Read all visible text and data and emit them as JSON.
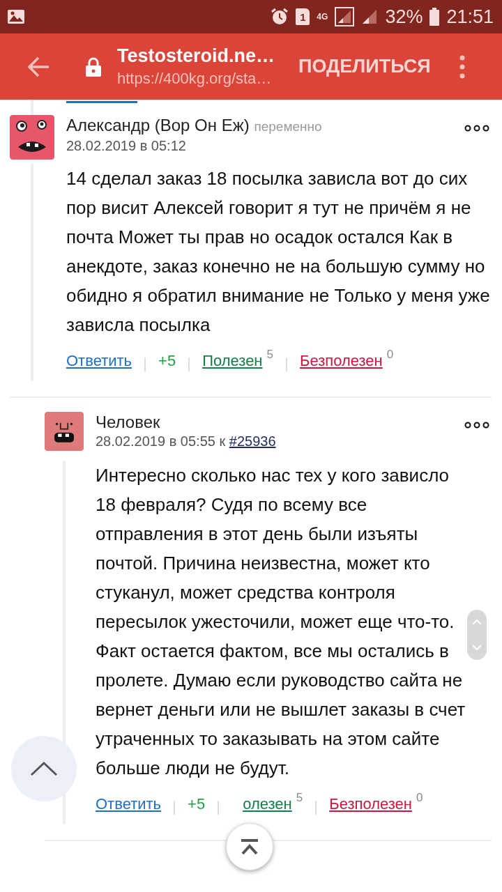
{
  "status_bar": {
    "sim": "1",
    "network": "4G",
    "battery": "32%",
    "time": "21:51"
  },
  "toolbar": {
    "title": "Testosteroid.ne…",
    "url": "https://400kg.org/sta…",
    "share": "ПОДЕЛИТЬСЯ"
  },
  "comments": [
    {
      "author": "Александр (Вор Он Еж)",
      "role": "переменно",
      "date": "28.02.2019 в 05:12",
      "body": "14 сделал заказ 18 посылка зависла вот до сих пор висит Алексей говорит я тут не причём я не почта Может ты прав но осадок остался Как в анекдоте, заказ конечно не на большую сумму но обидно я обратил внимание не Только у меня уже зависла посылка",
      "actions": {
        "reply": "Ответить",
        "score": "+5",
        "useful": "Полезен",
        "useful_count": "5",
        "useless": "Безполезен",
        "useless_count": "0"
      },
      "children": [
        {
          "author": "Человек",
          "date": "28.02.2019 в 05:55",
          "reply_prefix": "к",
          "reply_to": "#25936",
          "body": "Интересно сколько нас тех у кого зависло 18 февраля? Судя по всему все отправления в этот день были изъяты почтой. Причина неизвестна, может кто стуканул, может средства контроля пересылок ужесточили, может еще что-то. Факт остается фактом, все мы остались в пролете. Думаю если руководство сайта не вернет деньги или не вышлет заказы в счет утраченных то заказывать на этом сайте больше люди не будут.",
          "actions": {
            "reply": "Ответить",
            "score": "+5",
            "useful": "олезен",
            "useful_count": "5",
            "useless": "Безполезен",
            "useless_count": "0"
          }
        }
      ]
    }
  ]
}
